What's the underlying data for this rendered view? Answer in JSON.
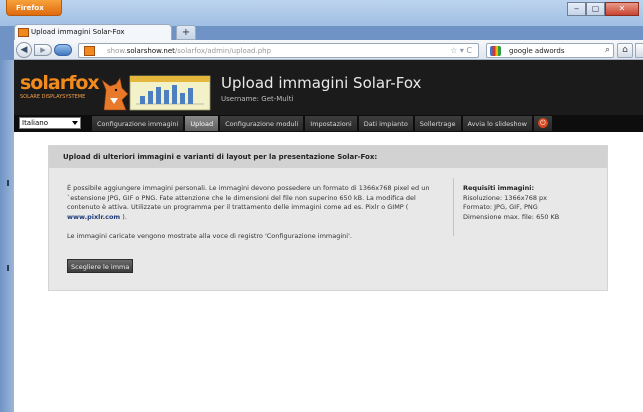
{
  "browser": {
    "app_button": "Firefox",
    "tab_title": "Upload immagini Solar-Fox",
    "new_tab": "+",
    "url_prefix": "show.",
    "url_domain": "solarshow.net",
    "url_path": "/solarfox/admin/upload.php",
    "search_value": "google adwords",
    "window_controls": {
      "minimize": "‒",
      "maximize": "▢",
      "close": "✕"
    }
  },
  "header": {
    "logo_text": "solarfox",
    "logo_sub": "SOLARE DISPLAYSYSTEME",
    "title": "Upload immagini Solar-Fox",
    "username": "Username: Get-Multi"
  },
  "menu": {
    "language": "Italiano",
    "items": [
      {
        "label": "Configurazione immagini",
        "active": false
      },
      {
        "label": "Upload",
        "active": true
      },
      {
        "label": "Configurazione moduli",
        "active": false
      },
      {
        "label": "Impostazioni",
        "active": false
      },
      {
        "label": "Dati impianto",
        "active": false
      },
      {
        "label": "Sollertrage",
        "active": false
      },
      {
        "label": "Avvia lo slideshow",
        "active": false
      }
    ]
  },
  "panel": {
    "heading": "Upload di ulteriori immagini e varianti di layout per la presentazione Solar-Fox:",
    "intro_before_link": "È possibile aggiungere immagini personali. Le immagini devono possedere un formato di 1366x768 pixel ed un `estensione JPG, GIF o PNG. Fate attenzione che le dimensioni del file non superino 650 kB. La modifica del contenuto è attiva. Utilizzate un programma per il trattamento delle immagini come ad es. Pixlr o GIMP (",
    "intro_link": "www.pixlr.com",
    "intro_after_link": ").",
    "intro2": "Le immagini caricate vengono mostrate alla voce di registro 'Configurazione immagini'.",
    "requirements_title": "Requisiti immagini:",
    "requirements": [
      "Risoluzione: 1366x768 px",
      "Formato: JPG, GIF, PNG",
      "Dimensione max. file: 650 KB"
    ],
    "choose_button": "Scegliere le imma"
  }
}
